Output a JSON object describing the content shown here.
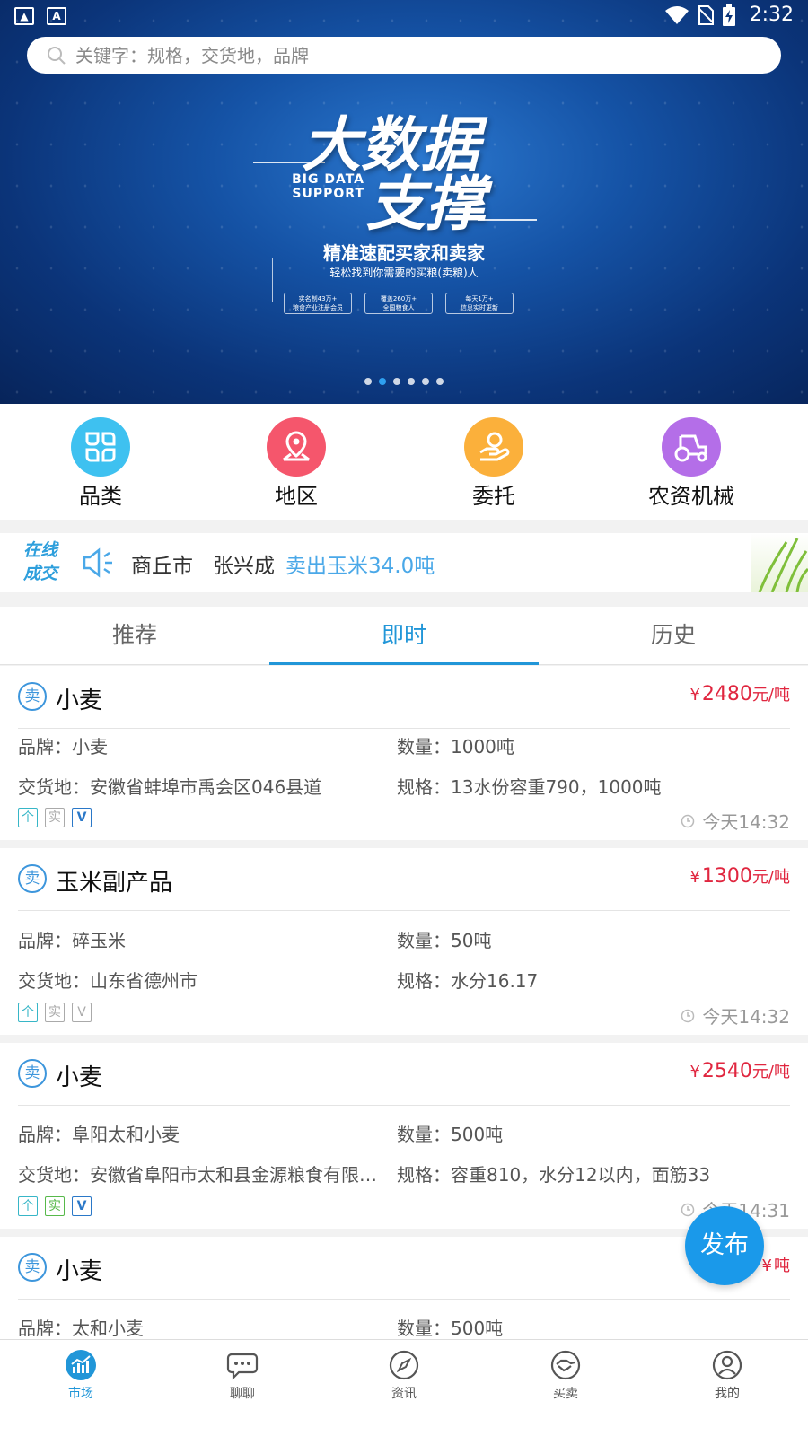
{
  "status_bar": {
    "time": "2:32"
  },
  "search": {
    "placeholder": "关键字：规格，交货地，品牌"
  },
  "banner": {
    "title_line1": "大数据",
    "title_line2": "支撑",
    "title_en_line1": "BIG DATA",
    "title_en_line2": "SUPPORT",
    "headline": "精准速配买家和卖家",
    "subline": "轻松找到你需要的买粮(卖粮)人",
    "stats": [
      {
        "line1": "实名制43万+",
        "line2": "粮食产业注册会员"
      },
      {
        "line1": "覆盖260万+",
        "line2": "全国粮食人"
      },
      {
        "line1": "每天1万+",
        "line2": "信息实时更新"
      }
    ],
    "page_count": 6,
    "active_page": 1
  },
  "categories": [
    {
      "label": "品类",
      "icon": "clover-icon",
      "color": "#3ec1f0"
    },
    {
      "label": "地区",
      "icon": "location-pin-icon",
      "color": "#f5566c"
    },
    {
      "label": "委托",
      "icon": "hand-coin-icon",
      "color": "#fbb03b"
    },
    {
      "label": "农资机械",
      "icon": "tractor-icon",
      "color": "#b46ee8"
    }
  ],
  "ticker": {
    "logo_line1": "在线",
    "logo_line2": "成交",
    "city": "商丘市",
    "person": "张兴成",
    "action": "卖出玉米34.0吨"
  },
  "tabs": [
    {
      "label": "推荐",
      "active": false
    },
    {
      "label": "即时",
      "active": true
    },
    {
      "label": "历史",
      "active": false
    }
  ],
  "listings": [
    {
      "badge": "卖",
      "name": "小麦",
      "price": "2480",
      "currency": "¥",
      "unit": "元/吨",
      "brand_label": "品牌：",
      "brand": "小麦",
      "qty_label": "数量：",
      "qty": "1000吨",
      "place_label": "交货地：",
      "place": "安徽省蚌埠市禹会区046县道",
      "spec_label": "规格：",
      "spec": "13水份容重790，1000吨",
      "tags": [
        {
          "t": "个",
          "on": true
        },
        {
          "t": "实",
          "on": false
        },
        {
          "t": "V",
          "on": true
        }
      ],
      "time": "今天14:32"
    },
    {
      "badge": "卖",
      "name": "玉米副产品",
      "price": "1300",
      "currency": "¥",
      "unit": "元/吨",
      "brand_label": "品牌：",
      "brand": "碎玉米",
      "qty_label": "数量：",
      "qty": "50吨",
      "place_label": "交货地：",
      "place": "山东省德州市",
      "spec_label": "规格：",
      "spec": "水分16.17",
      "tags": [
        {
          "t": "个",
          "on": true
        },
        {
          "t": "实",
          "on": false
        },
        {
          "t": "V",
          "on": false
        }
      ],
      "time": "今天14:32"
    },
    {
      "badge": "卖",
      "name": "小麦",
      "price": "2540",
      "currency": "¥",
      "unit": "元/吨",
      "brand_label": "品牌：",
      "brand": "阜阳太和小麦",
      "qty_label": "数量：",
      "qty": "500吨",
      "place_label": "交货地：",
      "place": "安徽省阜阳市太和县金源粮食有限…",
      "spec_label": "规格：",
      "spec": "容重810，水分12以内，面筋33",
      "tags": [
        {
          "t": "个",
          "on": true
        },
        {
          "t": "实",
          "on": true
        },
        {
          "t": "V",
          "on": true
        }
      ],
      "time": "今天14:31"
    },
    {
      "badge": "卖",
      "name": "小麦",
      "price": "",
      "currency": "¥",
      "unit": "吨",
      "brand_label": "品牌：",
      "brand": "太和小麦",
      "qty_label": "数量：",
      "qty": "500吨"
    }
  ],
  "fab": {
    "label": "发布"
  },
  "bottom_nav": [
    {
      "label": "市场",
      "icon": "market-chart-icon",
      "active": true
    },
    {
      "label": "聊聊",
      "icon": "chat-bubble-icon",
      "active": false
    },
    {
      "label": "资讯",
      "icon": "compass-icon",
      "active": false
    },
    {
      "label": "买卖",
      "icon": "handshake-icon",
      "active": false
    },
    {
      "label": "我的",
      "icon": "user-icon",
      "active": false
    }
  ],
  "colors": {
    "accent": "#2196d8",
    "price": "#e0263f",
    "fab": "#1a99ea"
  }
}
